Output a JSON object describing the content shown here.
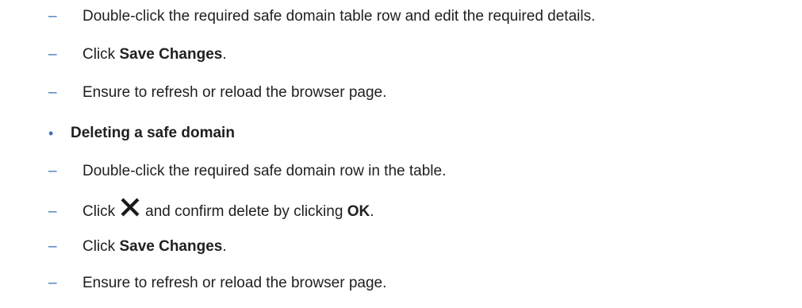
{
  "edit_steps": {
    "step1": "Double-click the required safe domain table row and edit the required details.",
    "step2_prefix": "Click ",
    "step2_bold": "Save Changes",
    "step2_suffix": ".",
    "step3": "Ensure to refresh or reload the browser page."
  },
  "delete_section": {
    "heading": "Deleting a safe domain",
    "step1": "Double-click the required safe domain row in the table.",
    "step2_prefix": "Click",
    "step2_middle": "and confirm delete by clicking ",
    "step2_bold": "OK",
    "step2_suffix": ".",
    "step3_prefix": "Click ",
    "step3_bold": "Save Changes",
    "step3_suffix": ".",
    "step4": "Ensure to refresh or reload the browser page."
  },
  "markers": {
    "dash": "–",
    "bullet": "•"
  },
  "icons": {
    "delete": "close-icon"
  },
  "colors": {
    "marker": "#3b76b8",
    "text": "#1f1f1f"
  }
}
